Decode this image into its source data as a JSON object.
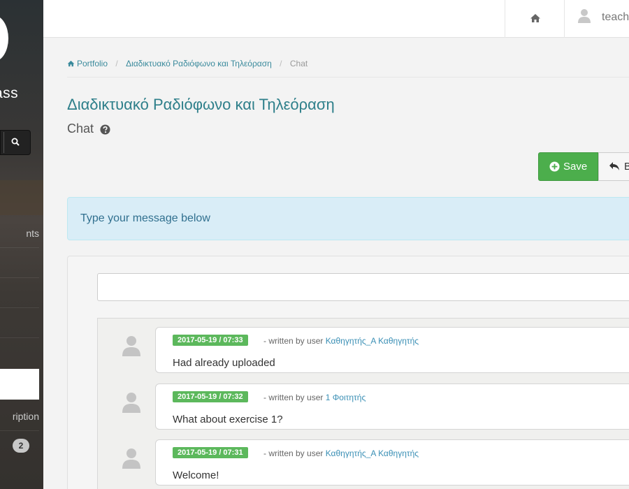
{
  "sidebar": {
    "logo_text": "ass",
    "items": [
      {
        "label": "nts"
      },
      {
        "label": ""
      },
      {
        "label": ""
      },
      {
        "label": ""
      },
      {
        "label": "ription"
      }
    ],
    "badge": "2"
  },
  "topbar": {
    "user_name": "teach"
  },
  "breadcrumb": {
    "items": [
      "Portfolio",
      "Διαδικτυακό Ραδιόφωνο και Τηλεόραση",
      "Chat"
    ]
  },
  "page": {
    "title": "Διαδικτυακό Ραδιόφωνο και Τηλεόραση",
    "subtitle": "Chat"
  },
  "actions": {
    "save_label": "Save",
    "back_label": "B"
  },
  "alert": {
    "text": "Type your message below"
  },
  "chat": {
    "input_value": "",
    "messages": [
      {
        "timestamp": "2017-05-19 / 07:33",
        "written_by": "- written by user",
        "user": "Καθηγητής_Α Καθηγητής",
        "text": "Had already uploaded"
      },
      {
        "timestamp": "2017-05-19 / 07:32",
        "written_by": "- written by user",
        "user": "1 Φοιτητής",
        "text": "What about exercise 1?"
      },
      {
        "timestamp": "2017-05-19 / 07:31",
        "written_by": "- written by user",
        "user": "Καθηγητής_Α Καθηγητής",
        "text": "Welcome!"
      }
    ]
  },
  "colors": {
    "accent": "#2e7f8a",
    "success": "#5cb85c",
    "info_bg": "#d9edf7",
    "link": "#3a8fb5"
  }
}
